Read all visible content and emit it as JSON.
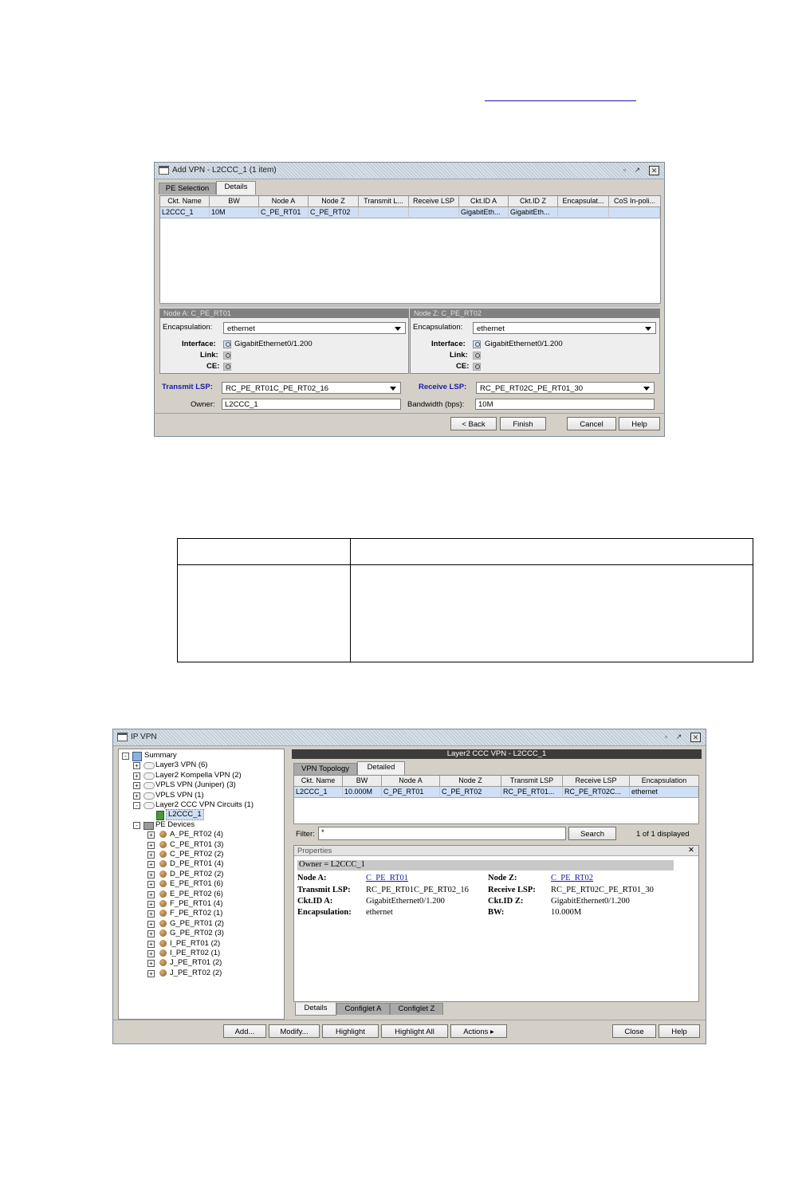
{
  "top_link_text": "",
  "add_vpn": {
    "title": "Add VPN - L2CCC_1 (1 item)",
    "tabs": [
      "PE Selection",
      "Details"
    ],
    "columns": [
      "Ckt. Name",
      "BW",
      "Node A",
      "Node Z",
      "Transmit L...",
      "Receive LSP",
      "Ckt.ID A",
      "Ckt.ID Z",
      "Encapsulat...",
      "CoS In-poli..."
    ],
    "row": [
      "L2CCC_1",
      "10M",
      "C_PE_RT01",
      "C_PE_RT02",
      "",
      "",
      "GigabitEth...",
      "GigabitEth...",
      "",
      ""
    ],
    "node_a": {
      "header": "Node A: C_PE_RT01",
      "encapsulation_label": "Encapsulation:",
      "encapsulation_value": "ethernet",
      "interface_label": "Interface:",
      "interface_value": "GigabitEthernet0/1.200",
      "link_label": "Link:",
      "ce_label": "CE:"
    },
    "node_z": {
      "header": "Node Z: C_PE_RT02",
      "encapsulation_label": "Encapsulation:",
      "encapsulation_value": "ethernet",
      "interface_label": "Interface:",
      "interface_value": "GigabitEthernet0/1.200",
      "link_label": "Link:",
      "ce_label": "CE:"
    },
    "transmit_lsp_label": "Transmit LSP:",
    "transmit_lsp_value": "RC_PE_RT01C_PE_RT02_16",
    "receive_lsp_label": "Receive LSP:",
    "receive_lsp_value": "RC_PE_RT02C_PE_RT01_30",
    "owner_label": "Owner:",
    "owner_value": "L2CCC_1",
    "bandwidth_label": "Bandwidth (bps):",
    "bandwidth_value": "10M",
    "buttons": {
      "back": "< Back",
      "finish": "Finish",
      "cancel": "Cancel",
      "help": "Help"
    }
  },
  "ip_vpn": {
    "title": "IP VPN",
    "tree": [
      {
        "label": "Summary",
        "level": 0,
        "icon": "summary-icon",
        "exp": "−"
      },
      {
        "label": "Layer3 VPN (6)",
        "level": 1,
        "icon": "cloud-icon",
        "exp": "+"
      },
      {
        "label": "Layer2 Kompella VPN (2)",
        "level": 1,
        "icon": "cloud-icon",
        "exp": "+"
      },
      {
        "label": "VPLS VPN (Juniper) (3)",
        "level": 1,
        "icon": "cloud-icon",
        "exp": "+"
      },
      {
        "label": "VPLS VPN (1)",
        "level": 1,
        "icon": "cloud-icon",
        "exp": "+"
      },
      {
        "label": "Layer2 CCC VPN Circuits (1)",
        "level": 1,
        "icon": "cloud-icon",
        "exp": "−"
      },
      {
        "label": "L2CCC_1",
        "level": 2,
        "icon": "circuit-icon",
        "exp": ""
      },
      {
        "label": "PE Devices",
        "level": 1,
        "icon": "devices-icon",
        "exp": "−"
      },
      {
        "label": "A_PE_RT02 (4)",
        "level": 2,
        "icon": "router-icon",
        "exp": "+"
      },
      {
        "label": "C_PE_RT01 (3)",
        "level": 2,
        "icon": "router-icon",
        "exp": "+"
      },
      {
        "label": "C_PE_RT02 (2)",
        "level": 2,
        "icon": "router-icon",
        "exp": "+"
      },
      {
        "label": "D_PE_RT01 (4)",
        "level": 2,
        "icon": "router-icon",
        "exp": "+"
      },
      {
        "label": "D_PE_RT02 (2)",
        "level": 2,
        "icon": "router-icon",
        "exp": "+"
      },
      {
        "label": "E_PE_RT01 (6)",
        "level": 2,
        "icon": "router-icon",
        "exp": "+"
      },
      {
        "label": "E_PE_RT02 (6)",
        "level": 2,
        "icon": "router-icon",
        "exp": "+"
      },
      {
        "label": "F_PE_RT01 (4)",
        "level": 2,
        "icon": "router-icon",
        "exp": "+"
      },
      {
        "label": "F_PE_RT02 (1)",
        "level": 2,
        "icon": "router-icon",
        "exp": "+"
      },
      {
        "label": "G_PE_RT01 (2)",
        "level": 2,
        "icon": "router-icon",
        "exp": "+"
      },
      {
        "label": "G_PE_RT02 (3)",
        "level": 2,
        "icon": "router-icon",
        "exp": "+"
      },
      {
        "label": "I_PE_RT01 (2)",
        "level": 2,
        "icon": "router-icon",
        "exp": "+"
      },
      {
        "label": "I_PE_RT02 (1)",
        "level": 2,
        "icon": "router-icon",
        "exp": "+"
      },
      {
        "label": "J_PE_RT01 (2)",
        "level": 2,
        "icon": "router-icon",
        "exp": "+"
      },
      {
        "label": "J_PE_RT02 (2)",
        "level": 2,
        "icon": "router-icon",
        "exp": "+"
      }
    ],
    "right_header": "Layer2 CCC VPN - L2CCC_1",
    "tabs": [
      "VPN Topology",
      "Detailed"
    ],
    "columns": [
      "Ckt. Name",
      "BW",
      "Node A",
      "Node Z",
      "Transmit LSP",
      "Receive LSP",
      "Encapsulation"
    ],
    "row": [
      "L2CCC_1",
      "10.000M",
      "C_PE_RT01",
      "C_PE_RT02",
      "RC_PE_RT01...",
      "RC_PE_RT02C...",
      "ethernet"
    ],
    "filter_label": "Filter:",
    "filter_value": "*",
    "search_button": "Search",
    "displayed": "1 of 1 displayed",
    "properties_title": "Properties",
    "properties_close": "✕",
    "owner_line": "Owner = L2CCC_1",
    "props": {
      "node_a_label": "Node A:",
      "node_a_value": "C_PE_RT01",
      "node_z_label": "Node Z:",
      "node_z_value": "C_PE_RT02",
      "tlsp_label": "Transmit LSP:",
      "tlsp_value": "RC_PE_RT01C_PE_RT02_16",
      "rlsp_label": "Receive LSP:",
      "rlsp_value": "RC_PE_RT02C_PE_RT01_30",
      "cida_label": "Ckt.ID A:",
      "cida_value": "GigabitEthernet0/1.200",
      "cidz_label": "Ckt.ID Z:",
      "cidz_value": "GigabitEthernet0/1.200",
      "enc_label": "Encapsulation:",
      "enc_value": "ethernet",
      "bw_label": "BW:",
      "bw_value": "10.000M"
    },
    "bottom_tabs": [
      "Details",
      "Configlet A",
      "Configlet Z"
    ],
    "buttons": {
      "add": "Add...",
      "modify": "Modify...",
      "highlight": "Highlight",
      "highlight_all": "Highlight All",
      "actions": "Actions ▸",
      "close": "Close",
      "help": "Help"
    }
  }
}
